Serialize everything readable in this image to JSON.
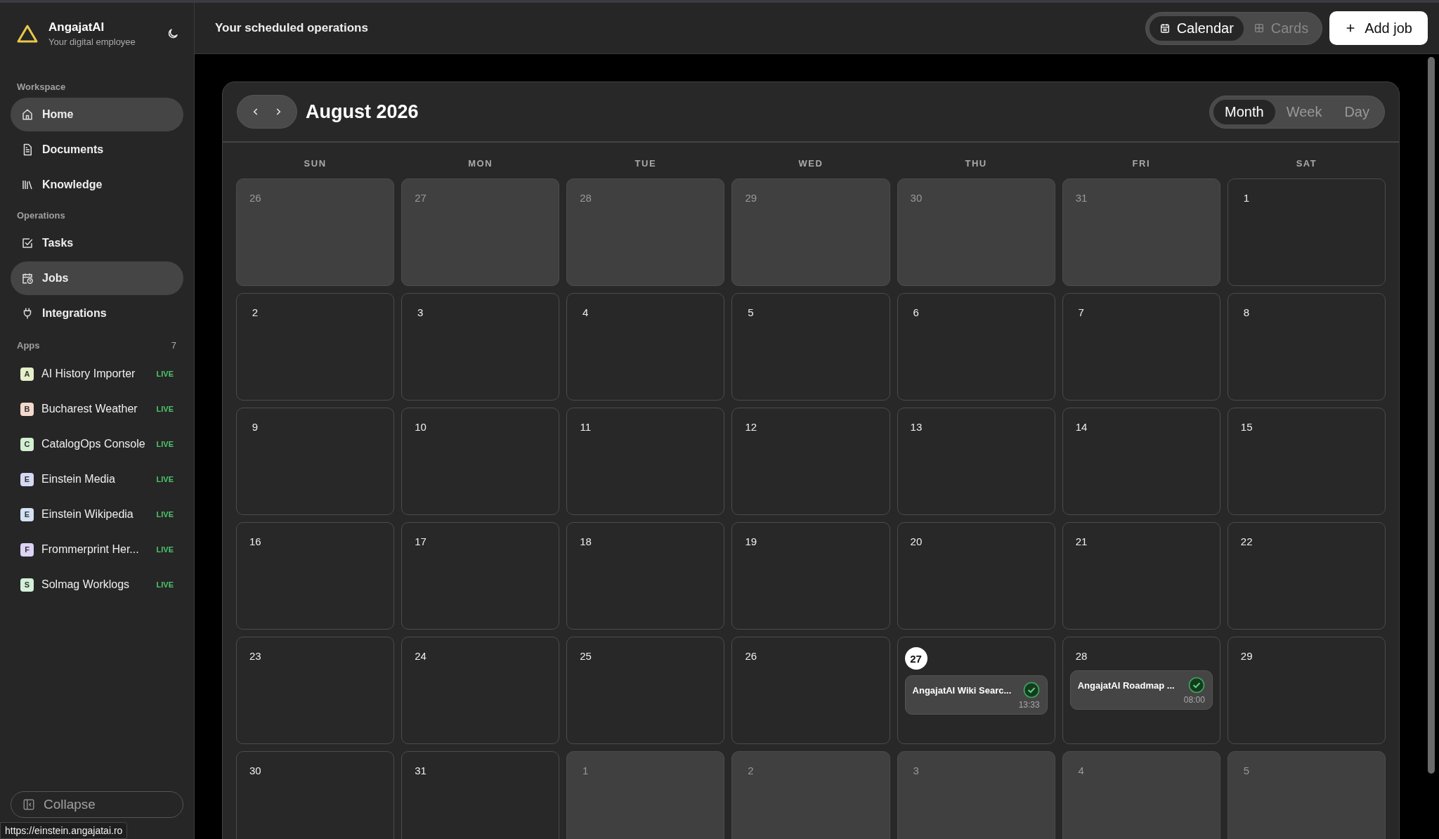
{
  "brand": {
    "name": "AngajatAI",
    "tagline": "Your digital employee"
  },
  "sidebar": {
    "sections": [
      {
        "title": "Workspace",
        "items": [
          {
            "label": "Home",
            "selected": true
          },
          {
            "label": "Documents",
            "selected": false
          },
          {
            "label": "Knowledge",
            "selected": false
          }
        ]
      },
      {
        "title": "Operations",
        "items": [
          {
            "label": "Tasks",
            "selected": false
          },
          {
            "label": "Jobs",
            "selected": true
          },
          {
            "label": "Integrations",
            "selected": false
          }
        ]
      }
    ],
    "apps": {
      "title": "Apps",
      "count": "7",
      "items": [
        {
          "letter": "A",
          "name": "AI History Importer",
          "status": "LIVE",
          "color": "#e6f0c8"
        },
        {
          "letter": "B",
          "name": "Bucharest Weather",
          "status": "LIVE",
          "color": "#f3d9cc"
        },
        {
          "letter": "C",
          "name": "CatalogOps Console",
          "status": "LIVE",
          "color": "#d3f0d0"
        },
        {
          "letter": "E",
          "name": "Einstein Media",
          "status": "LIVE",
          "color": "#d6d9f5"
        },
        {
          "letter": "E",
          "name": "Einstein Wikipedia",
          "status": "LIVE",
          "color": "#d3e2f5"
        },
        {
          "letter": "F",
          "name": "Frommerprint Her...",
          "status": "LIVE",
          "color": "#ddd3f5"
        },
        {
          "letter": "S",
          "name": "Solmag Worklogs",
          "status": "LIVE",
          "color": "#d3f0d8"
        }
      ]
    },
    "collapse": "Collapse"
  },
  "status_url": "https://einstein.angajatai.ro",
  "topbar": {
    "title": "Your scheduled operations",
    "views": [
      {
        "label": "Calendar",
        "selected": true
      },
      {
        "label": "Cards",
        "selected": false
      }
    ],
    "add_button": "Add job"
  },
  "calendar": {
    "month": "August 2026",
    "modes": [
      {
        "label": "Month",
        "selected": true
      },
      {
        "label": "Week",
        "selected": false
      },
      {
        "label": "Day",
        "selected": false
      }
    ],
    "weekdays": [
      "SUN",
      "MON",
      "TUE",
      "WED",
      "THU",
      "FRI",
      "SAT"
    ],
    "weeks": [
      [
        {
          "day": "26",
          "outside": true,
          "today": false
        },
        {
          "day": "27",
          "outside": true,
          "today": false
        },
        {
          "day": "28",
          "outside": true,
          "today": false
        },
        {
          "day": "29",
          "outside": true,
          "today": false
        },
        {
          "day": "30",
          "outside": true,
          "today": false
        },
        {
          "day": "31",
          "outside": true,
          "today": false
        },
        {
          "day": "1",
          "outside": false,
          "today": false
        }
      ],
      [
        {
          "day": "2",
          "outside": false,
          "today": false
        },
        {
          "day": "3",
          "outside": false,
          "today": false
        },
        {
          "day": "4",
          "outside": false,
          "today": false
        },
        {
          "day": "5",
          "outside": false,
          "today": false
        },
        {
          "day": "6",
          "outside": false,
          "today": false
        },
        {
          "day": "7",
          "outside": false,
          "today": false
        },
        {
          "day": "8",
          "outside": false,
          "today": false
        }
      ],
      [
        {
          "day": "9",
          "outside": false,
          "today": false
        },
        {
          "day": "10",
          "outside": false,
          "today": false
        },
        {
          "day": "11",
          "outside": false,
          "today": false
        },
        {
          "day": "12",
          "outside": false,
          "today": false
        },
        {
          "day": "13",
          "outside": false,
          "today": false
        },
        {
          "day": "14",
          "outside": false,
          "today": false
        },
        {
          "day": "15",
          "outside": false,
          "today": false
        }
      ],
      [
        {
          "day": "16",
          "outside": false,
          "today": false
        },
        {
          "day": "17",
          "outside": false,
          "today": false
        },
        {
          "day": "18",
          "outside": false,
          "today": false
        },
        {
          "day": "19",
          "outside": false,
          "today": false
        },
        {
          "day": "20",
          "outside": false,
          "today": false
        },
        {
          "day": "21",
          "outside": false,
          "today": false
        },
        {
          "day": "22",
          "outside": false,
          "today": false
        }
      ],
      [
        {
          "day": "23",
          "outside": false,
          "today": false
        },
        {
          "day": "24",
          "outside": false,
          "today": false
        },
        {
          "day": "25",
          "outside": false,
          "today": false
        },
        {
          "day": "26",
          "outside": false,
          "today": false
        },
        {
          "day": "27",
          "outside": false,
          "today": true,
          "events": [
            {
              "title": "AngajatAI Wiki Searc...",
              "time": "13:33",
              "done": true
            }
          ]
        },
        {
          "day": "28",
          "outside": false,
          "today": false,
          "events": [
            {
              "title": "AngajatAI Roadmap ...",
              "time": "08:00",
              "done": true
            }
          ]
        },
        {
          "day": "29",
          "outside": false,
          "today": false
        }
      ],
      [
        {
          "day": "30",
          "outside": false,
          "today": false
        },
        {
          "day": "31",
          "outside": false,
          "today": false
        },
        {
          "day": "1",
          "outside": true,
          "today": false
        },
        {
          "day": "2",
          "outside": true,
          "today": false
        },
        {
          "day": "3",
          "outside": true,
          "today": false
        },
        {
          "day": "4",
          "outside": true,
          "today": false
        },
        {
          "day": "5",
          "outside": true,
          "today": false
        }
      ]
    ]
  }
}
